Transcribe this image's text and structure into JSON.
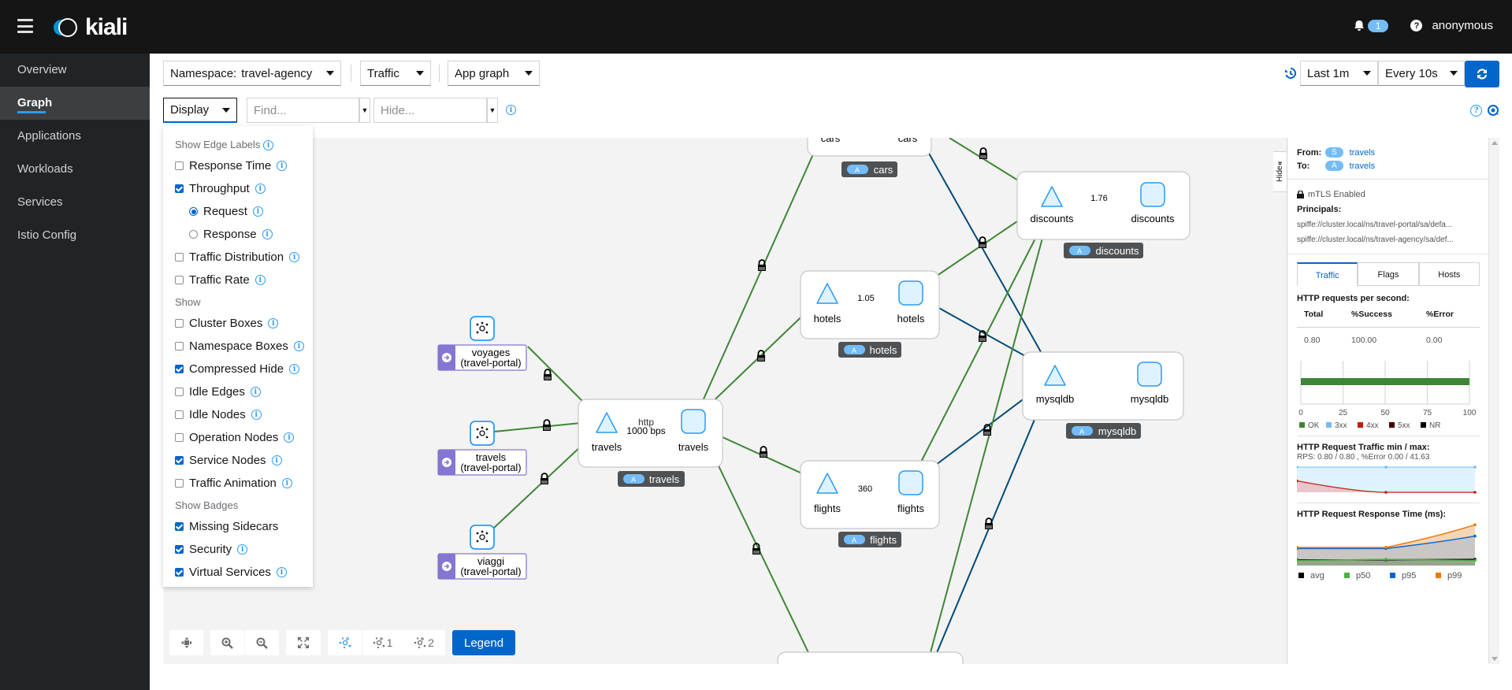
{
  "header": {
    "brand": "kiali",
    "notification_count": "1",
    "user": "anonymous"
  },
  "sidebar": {
    "items": [
      {
        "label": "Overview",
        "active": false
      },
      {
        "label": "Graph",
        "active": true
      },
      {
        "label": "Applications",
        "active": false
      },
      {
        "label": "Workloads",
        "active": false
      },
      {
        "label": "Services",
        "active": false
      },
      {
        "label": "Istio Config",
        "active": false
      }
    ]
  },
  "toolbar": {
    "namespace_label": "Namespace:",
    "namespace_value": "travel-agency",
    "traffic": "Traffic",
    "graph_type": "App graph",
    "display": "Display",
    "find_placeholder": "Find...",
    "hide_placeholder": "Hide...",
    "duration": "Last 1m",
    "refresh_interval": "Every 10s"
  },
  "display_menu": {
    "edge_labels_heading": "Show Edge Labels",
    "edge_labels": [
      {
        "label": "Response Time",
        "type": "checkbox",
        "checked": false
      },
      {
        "label": "Throughput",
        "type": "checkbox",
        "checked": true
      },
      {
        "label": "Request",
        "type": "radio",
        "checked": true
      },
      {
        "label": "Response",
        "type": "radio",
        "checked": false
      },
      {
        "label": "Traffic Distribution",
        "type": "checkbox",
        "checked": false
      },
      {
        "label": "Traffic Rate",
        "type": "checkbox",
        "checked": false
      }
    ],
    "show_heading": "Show",
    "show": [
      {
        "label": "Cluster Boxes",
        "checked": false
      },
      {
        "label": "Namespace Boxes",
        "checked": false
      },
      {
        "label": "Compressed Hide",
        "checked": true
      },
      {
        "label": "Idle Edges",
        "checked": false
      },
      {
        "label": "Idle Nodes",
        "checked": false
      },
      {
        "label": "Operation Nodes",
        "checked": false
      },
      {
        "label": "Service Nodes",
        "checked": true
      },
      {
        "label": "Traffic Animation",
        "checked": false
      }
    ],
    "badges_heading": "Show Badges",
    "badges": [
      {
        "label": "Missing Sidecars",
        "checked": true
      },
      {
        "label": "Security",
        "checked": true
      },
      {
        "label": "Virtual Services",
        "checked": true
      }
    ]
  },
  "graph": {
    "sources": [
      {
        "name": "voyages",
        "namespace": "(travel-portal)"
      },
      {
        "name": "travels",
        "namespace": "(travel-portal)"
      },
      {
        "name": "viaggi",
        "namespace": "(travel-portal)"
      }
    ],
    "apps": {
      "travels": {
        "service": "travels",
        "workload": "travels",
        "box": "travels",
        "edge_label_1": "http",
        "edge_label_2": "1000 bps"
      },
      "cars": {
        "service": "cars",
        "workload": "cars",
        "box": "cars"
      },
      "hotels": {
        "service": "hotels",
        "workload": "hotels",
        "box": "hotels",
        "edge_label": "1.05"
      },
      "flights": {
        "service": "flights",
        "workload": "flights",
        "box": "flights",
        "edge_label": "360"
      },
      "discounts": {
        "service": "discounts",
        "workload": "discounts",
        "box": "discounts",
        "edge_label": "1.76"
      },
      "mysqldb": {
        "service": "mysqldb",
        "workload": "mysqldb",
        "box": "mysqldb"
      }
    },
    "app_badge": "A",
    "controls": {
      "layout_default": "",
      "layout_1": "1",
      "layout_2": "2",
      "legend": "Legend"
    }
  },
  "side_panel": {
    "hide_label": "Hide",
    "from_label": "From:",
    "from_badge": "S",
    "from_name": "travels",
    "to_label": "To:",
    "to_badge": "A",
    "to_name": "travels",
    "mtls": "mTLS Enabled",
    "principals_label": "Principals:",
    "principals": [
      "spiffe://cluster.local/ns/travel-portal/sa/defa...",
      "spiffe://cluster.local/ns/travel-agency/sa/def..."
    ],
    "tabs": [
      "Traffic",
      "Flags",
      "Hosts"
    ],
    "active_tab": "Traffic",
    "http_rps_title": "HTTP requests per second:",
    "table_headers": [
      "Total",
      "%Success",
      "%Error"
    ],
    "table_values": [
      "0.80",
      "100.00",
      "0.00"
    ],
    "traffic_min_max_title": "HTTP Request Traffic min / max:",
    "traffic_min_max_text": "RPS: 0.80 / 0.80 , %Error 0.00 / 41.63",
    "response_time_title": "HTTP Request Response Time (ms):"
  },
  "chart_data": [
    {
      "type": "bar",
      "title": "HTTP requests per second",
      "orientation": "horizontal-stacked",
      "categories": [
        ""
      ],
      "series": [
        {
          "name": "OK",
          "values": [
            100
          ],
          "color": "#3e8635"
        },
        {
          "name": "3xx",
          "values": [
            0
          ],
          "color": "#73bcf7"
        },
        {
          "name": "4xx",
          "values": [
            0
          ],
          "color": "#c9190b"
        },
        {
          "name": "5xx",
          "values": [
            0
          ],
          "color": "#470000"
        },
        {
          "name": "NR",
          "values": [
            0
          ],
          "color": "#000000"
        }
      ],
      "xticks": [
        "0",
        "25",
        "50",
        "75",
        "100"
      ],
      "xlim": [
        0,
        100
      ],
      "legend": "bottom",
      "grid": true
    },
    {
      "type": "area",
      "title": "HTTP Request Traffic min / max",
      "x": [
        0,
        1,
        2
      ],
      "series": [
        {
          "name": "RPS",
          "values": [
            0.8,
            0.8,
            0.8
          ],
          "color": "#73bcf7"
        },
        {
          "name": "%Error",
          "values": [
            41.63,
            0.0,
            0.0
          ],
          "color": "#c9190b"
        }
      ]
    },
    {
      "type": "area",
      "title": "HTTP Request Response Time (ms)",
      "x": [
        0,
        1,
        2
      ],
      "series": [
        {
          "name": "avg",
          "values": [
            10,
            10,
            11
          ],
          "color": "#000000"
        },
        {
          "name": "p50",
          "values": [
            9,
            11,
            9
          ],
          "color": "#4cb140"
        },
        {
          "name": "p95",
          "values": [
            30,
            30,
            52
          ],
          "color": "#0066cc"
        },
        {
          "name": "p99",
          "values": [
            32,
            32,
            72
          ],
          "color": "#ec7a08"
        }
      ],
      "legend": "bottom"
    }
  ]
}
